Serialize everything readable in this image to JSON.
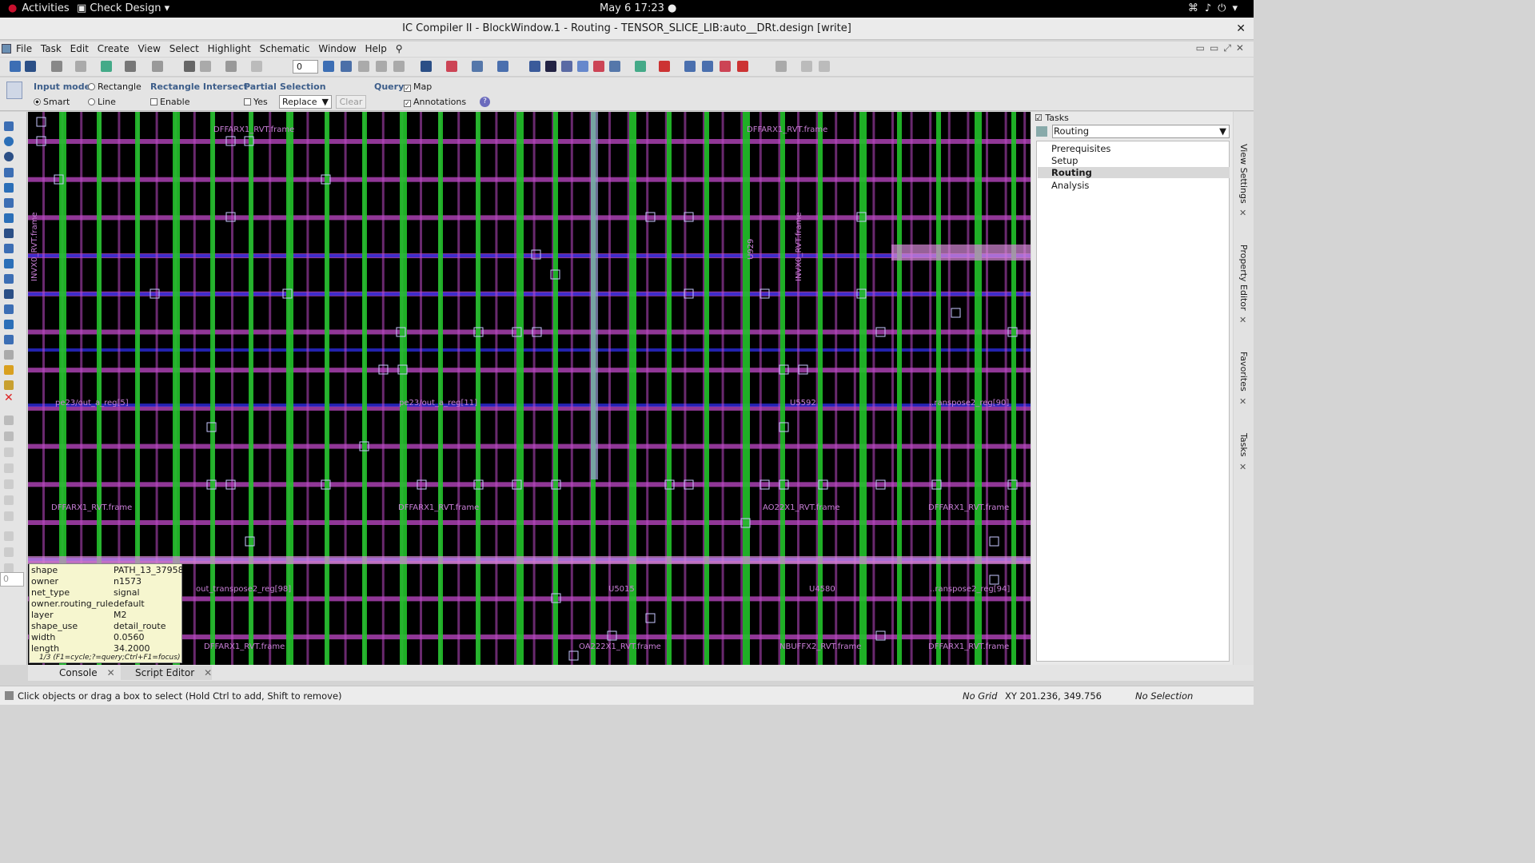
{
  "topbar": {
    "activities": "Activities",
    "app_menu": "Check Design",
    "clock": "May 6  17:23"
  },
  "window": {
    "title": "IC Compiler II - BlockWindow.1 - Routing - TENSOR_SLICE_LIB:auto__DRt.design [write]"
  },
  "menu": [
    "File",
    "Task",
    "Edit",
    "Create",
    "View",
    "Select",
    "Highlight",
    "Schematic",
    "Window",
    "Help"
  ],
  "toolbar": {
    "spin_value": "0"
  },
  "input_bar": {
    "input_mode_label": "Input mode",
    "rectangle": "Rectangle",
    "smart": "Smart",
    "line": "Line",
    "rect_intersect_label": "Rectangle Intersect",
    "enable": "Enable",
    "partial_label": "Partial",
    "yes": "Yes",
    "selection_label": "Selection",
    "selection_value": "Replace",
    "clear": "Clear",
    "query_label": "Query",
    "map": "Map",
    "annotations": "Annotations"
  },
  "layout_labels": {
    "l1": "DFFARX1_RVT.frame",
    "l2": "DFFARX1_RVT.frame",
    "l3": "INVX0_RVT.frame",
    "l4": "INVX0_RVT.frame",
    "l5": "pe23/out_a_reg[5]",
    "l6": "pe23/out_a_reg[11]",
    "l7": "U5592",
    "l8": "..ranspose2_reg[90]",
    "l9": "DFFARX1_RVT.frame",
    "l10": "DFFARX1_RVT.frame",
    "l11": "AO22X1_RVT.frame",
    "l12": "DFFARX1_RVT.frame",
    "l13": "out_transpose2_reg[98]",
    "l14": "U5015",
    "l15": "U4580",
    "l16": "..ranspose2_reg[94]",
    "l17": "DFFARX1_RVT.frame",
    "l18": "OA222X1_RVT.frame",
    "l19": "NBUFFX2_RVT.frame",
    "l20": "DFFARX1_RVT.frame",
    "l21": "U929"
  },
  "tooltip": {
    "rows": [
      {
        "k": "shape",
        "v": "PATH_13_37958"
      },
      {
        "k": "owner",
        "v": "n1573"
      },
      {
        "k": "net_type",
        "v": "signal"
      },
      {
        "k": "owner.routing_rule",
        "v": "default"
      },
      {
        "k": "layer",
        "v": "M2"
      },
      {
        "k": "shape_use",
        "v": "detail_route"
      },
      {
        "k": "width",
        "v": "0.0560"
      },
      {
        "k": "length",
        "v": "34.2000"
      }
    ],
    "hint": "1/3 (F1=cycle;?=query;Ctrl+F1=focus)"
  },
  "tasks": {
    "header": "Tasks",
    "dropdown": "Routing",
    "items": [
      "Prerequisites",
      "Setup",
      "Routing",
      "Analysis"
    ],
    "selected": "Routing"
  },
  "side_tabs": [
    "View Settings",
    "Property Editor",
    "Favorites",
    "Tasks"
  ],
  "bottom_tabs": [
    "Console",
    "Script Editor"
  ],
  "left_spin": "0",
  "status": {
    "message": "Click objects or drag a box to select (Hold Ctrl to add, Shift to remove)",
    "grid": "No Grid",
    "xy": "XY 201.236, 349.756",
    "selection": "No Selection"
  },
  "colors": {
    "metal_green": "#22c22a",
    "metal_magenta": "#c04ac8",
    "metal_blue": "#2a2ad8",
    "label_pink": "#c87fd6"
  }
}
